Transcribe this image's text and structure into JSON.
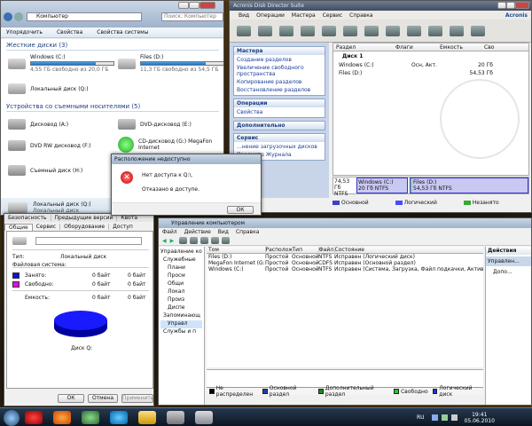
{
  "explorer": {
    "address": "Компьютер",
    "search_placeholder": "Поиск: Компьютер",
    "toolbar": [
      "Упорядочить",
      "Свойства",
      "Свойства системы"
    ],
    "group_hdd": "Жесткие диски (3)",
    "drives": [
      {
        "name": "Windows (C:)",
        "free": "4,55 ГБ свободно из 20,0 ГБ",
        "fill": 0.78
      },
      {
        "name": "Files (D:)",
        "free": "11,3 ГБ свободно из 54,5 ГБ",
        "fill": 0.79
      },
      {
        "name": "Локальный диск (Q:)",
        "free": "",
        "fill": 0
      }
    ],
    "group_removable": "Устройства со съемными носителями (5)",
    "removable": [
      {
        "name": "Дисковод (A:)",
        "sub": ""
      },
      {
        "name": "DVD-дисковод (E:)",
        "sub": ""
      },
      {
        "name": "DVD RW дисковод (F:)",
        "sub": ""
      },
      {
        "name": "CD-дисковод (G:) MegaFon",
        "sub": "Internet"
      },
      {
        "name": "Съемный диск (H:)",
        "sub": ""
      }
    ],
    "status_name": "Локальный диск (Q:)",
    "status_type": "Локальный диск"
  },
  "acronis": {
    "title": "Acronis Disk Director Suite",
    "brand": "Acronis",
    "menu": [
      "Вид",
      "Операции",
      "Мастера",
      "Сервис",
      "Справка"
    ],
    "wizards_title": "Мастера",
    "wizards": [
      "Создание разделов",
      "Увеличение свободного пространства",
      "Копирование разделов",
      "Восстановление разделов"
    ],
    "operations_title": "Операции",
    "operations": [
      "Свойства"
    ],
    "extra_title": "Дополнительно",
    "service_title": "Сервис",
    "service": [
      "...нение загрузочных дисков",
      "Просмотр Журнала"
    ],
    "cols": [
      "Раздел",
      "Флаги",
      "Емкость",
      "Сво"
    ],
    "disk_label": "Диск 1",
    "partitions": [
      {
        "name": "Windows (C:)",
        "flags": "Осн, Акт.",
        "size": "20 Гб"
      },
      {
        "name": "Files (D:)",
        "flags": "",
        "size": "54,53 Гб"
      }
    ],
    "map_disk": "74,53 Гб",
    "map_ntfs": "NTFS",
    "map_c": {
      "name": "Windows (C:)",
      "size": "20 Гб  NTFS"
    },
    "map_d": {
      "name": "Files (D:)",
      "size": "54,53 Гб  NTFS"
    },
    "legend": [
      "Основной",
      "Логический",
      "Незанято"
    ]
  },
  "dialog": {
    "title": "Расположение недоступно",
    "line1": "Нет доступа к Q:\\.",
    "line2": "Отказано в доступе.",
    "ok": "ОК"
  },
  "props": {
    "tabs_row1": [
      "Безопасность",
      "Предыдущие версии",
      "Квота"
    ],
    "tabs_row2": [
      "Общие",
      "Сервис",
      "Оборудование",
      "Доступ"
    ],
    "type_label": "Тип:",
    "type_value": "Локальный диск",
    "fs_label": "Файловая система:",
    "used_label": "Занято:",
    "used_bytes": "0 байт",
    "used_short": "0 байт",
    "free_label": "Свободно:",
    "free_bytes": "0 байт",
    "free_short": "0 байт",
    "cap_label": "Емкость:",
    "cap_bytes": "0 байт",
    "cap_short": "0 байт",
    "disk_name": "Диск Q:",
    "ok": "ОК",
    "cancel": "Отмена",
    "apply": "Применить",
    "used_color": "#1010e0",
    "free_color": "#e010e0"
  },
  "mgmt": {
    "title": "Управление компьютером",
    "menu": [
      "Файл",
      "Действие",
      "Вид",
      "Справка"
    ],
    "tree": [
      "Управление ко",
      "Служебные",
      "Плани",
      "Просм",
      "Общи",
      "Локал",
      "Произ",
      "Диспе",
      "Запоминающ",
      "Управл",
      "Службы и п"
    ],
    "cols": [
      "Том",
      "Расположение",
      "Тип",
      "Файл...",
      "Состояние"
    ],
    "rows": [
      {
        "vol": "Files (D:)",
        "loc": "Простой",
        "type": "Основной",
        "fs": "NTFS",
        "state": "Исправен (Логический диск)"
      },
      {
        "vol": "MegaFon Internet (G:)",
        "loc": "Простой",
        "type": "Основной",
        "fs": "CDFS",
        "state": "Исправен (Основной раздел)"
      },
      {
        "vol": "Windows (C:)",
        "loc": "Простой",
        "type": "Основной",
        "fs": "NTFS",
        "state": "Исправен (Система, Загрузка, Файл подкачки, Активен, Авар"
      }
    ],
    "actions_title": "Действия",
    "actions": [
      "Управлен...",
      "Допо..."
    ],
    "legend": [
      {
        "label": "Не распределен",
        "color": "#000000"
      },
      {
        "label": "Основной раздел",
        "color": "#1a3fb0"
      },
      {
        "label": "Дополнительный раздел",
        "color": "#1a8a1a"
      },
      {
        "label": "Свободно",
        "color": "#22cc22"
      },
      {
        "label": "Логический диск",
        "color": "#2233cc"
      }
    ]
  },
  "taskbar": {
    "lang": "RU",
    "time": "19:41",
    "date": "05.06.2010"
  }
}
